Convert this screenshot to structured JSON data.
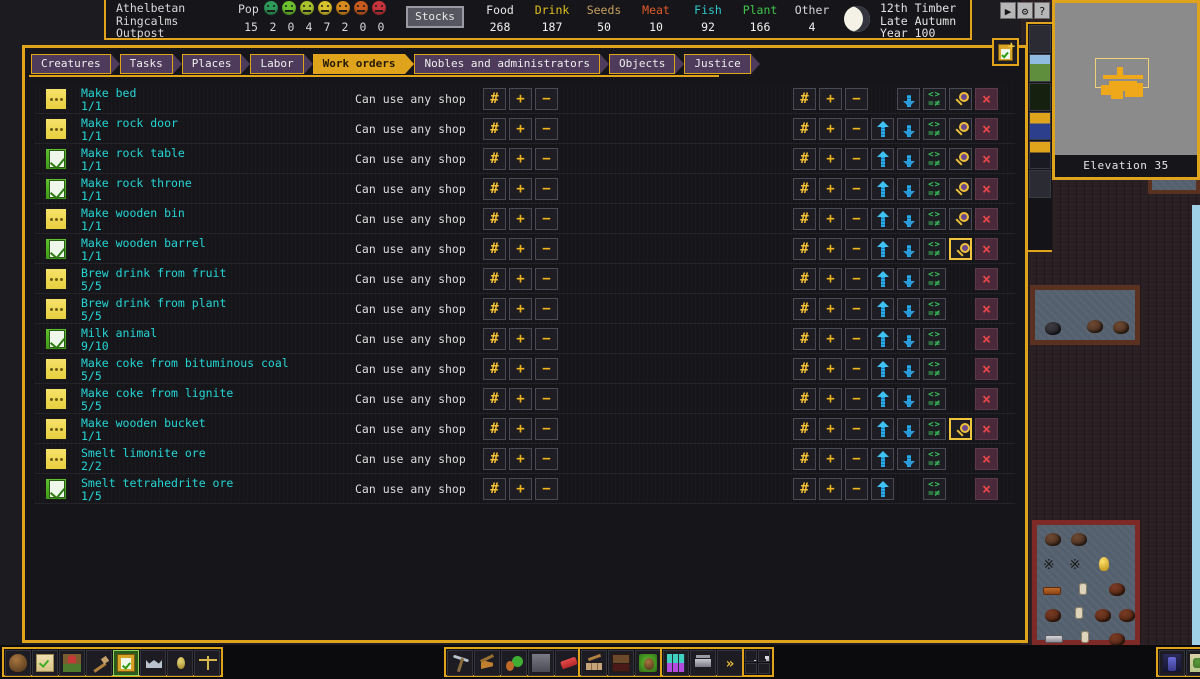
{
  "window": {
    "elevation_label": "Elevation 35"
  },
  "status_bar": {
    "fort_name_line1": "Athelbetan",
    "fort_name_line2": "Ringcalms",
    "fort_type": "Outpost",
    "pop_label": "Pop",
    "pop_total": "15",
    "mood_counts": [
      "2",
      "0",
      "4",
      "7",
      "2",
      "0",
      "0"
    ],
    "mood_colors": [
      "#2e9a5a",
      "#6cc22e",
      "#a8c22e",
      "#d8c22e",
      "#d88a1e",
      "#c85a1e",
      "#c8343c"
    ],
    "stocks_label": "Stocks",
    "resources": [
      {
        "name": "Food",
        "value": "268",
        "color": "#e8e8e8"
      },
      {
        "name": "Drink",
        "value": "187",
        "color": "#e0c020"
      },
      {
        "name": "Seeds",
        "value": "50",
        "color": "#c8a060"
      },
      {
        "name": "Meat",
        "value": "10",
        "color": "#e05a2a"
      },
      {
        "name": "Fish",
        "value": "92",
        "color": "#2ec8c8"
      },
      {
        "name": "Plant",
        "value": "166",
        "color": "#3fc44a"
      },
      {
        "name": "Other",
        "value": "4",
        "color": "#d8d8d8"
      }
    ],
    "date_line1": "12th Timber",
    "date_line2": "Late Autumn",
    "date_line3": "Year 100"
  },
  "top_right_controls": [
    "▶",
    "⚙",
    "?"
  ],
  "tabs": [
    {
      "label": "Creatures",
      "active": false
    },
    {
      "label": "Tasks",
      "active": false
    },
    {
      "label": "Places",
      "active": false
    },
    {
      "label": "Labor",
      "active": false
    },
    {
      "label": "Work orders",
      "active": true
    },
    {
      "label": "Nobles and administrators",
      "active": false
    },
    {
      "label": "Objects",
      "active": false
    },
    {
      "label": "Justice",
      "active": false
    }
  ],
  "add_order_button": {
    "label": "+",
    "name": "add-work-order"
  },
  "row_buttons": {
    "hash": "#",
    "plus": "+",
    "minus": "−",
    "delete": "×",
    "cond_top": "<>",
    "cond_bottom": "=≠"
  },
  "work_orders": [
    {
      "title": "Make bed",
      "count": "1/1",
      "shop": "Can use any shop",
      "status": "pending",
      "up": false,
      "down": true,
      "conditions": true,
      "details": true,
      "selected_details": false
    },
    {
      "title": "Make rock door",
      "count": "1/1",
      "shop": "Can use any shop",
      "status": "pending",
      "up": true,
      "down": true,
      "conditions": true,
      "details": true,
      "selected_details": false
    },
    {
      "title": "Make rock table",
      "count": "1/1",
      "shop": "Can use any shop",
      "status": "active",
      "up": true,
      "down": true,
      "conditions": true,
      "details": true,
      "selected_details": false
    },
    {
      "title": "Make rock throne",
      "count": "1/1",
      "shop": "Can use any shop",
      "status": "active",
      "up": true,
      "down": true,
      "conditions": true,
      "details": true,
      "selected_details": false
    },
    {
      "title": "Make wooden bin",
      "count": "1/1",
      "shop": "Can use any shop",
      "status": "pending",
      "up": true,
      "down": true,
      "conditions": true,
      "details": true,
      "selected_details": false
    },
    {
      "title": "Make wooden barrel",
      "count": "1/1",
      "shop": "Can use any shop",
      "status": "active",
      "up": true,
      "down": true,
      "conditions": true,
      "details": true,
      "selected_details": true
    },
    {
      "title": "Brew drink from fruit",
      "count": "5/5",
      "shop": "Can use any shop",
      "status": "pending",
      "up": true,
      "down": true,
      "conditions": true,
      "details": false,
      "selected_details": false
    },
    {
      "title": "Brew drink from plant",
      "count": "5/5",
      "shop": "Can use any shop",
      "status": "pending",
      "up": true,
      "down": true,
      "conditions": true,
      "details": false,
      "selected_details": false
    },
    {
      "title": "Milk animal",
      "count": "9/10",
      "shop": "Can use any shop",
      "status": "active",
      "up": true,
      "down": true,
      "conditions": true,
      "details": false,
      "selected_details": false
    },
    {
      "title": "Make coke from bituminous coal",
      "count": "5/5",
      "shop": "Can use any shop",
      "status": "pending",
      "up": true,
      "down": true,
      "conditions": true,
      "details": false,
      "selected_details": false
    },
    {
      "title": "Make coke from lignite",
      "count": "5/5",
      "shop": "Can use any shop",
      "status": "pending",
      "up": true,
      "down": true,
      "conditions": true,
      "details": false,
      "selected_details": false
    },
    {
      "title": "Make wooden bucket",
      "count": "1/1",
      "shop": "Can use any shop",
      "status": "pending",
      "up": true,
      "down": true,
      "conditions": true,
      "details": true,
      "selected_details": true
    },
    {
      "title": "Smelt limonite ore",
      "count": "2/2",
      "shop": "Can use any shop",
      "status": "pending",
      "up": true,
      "down": true,
      "conditions": true,
      "details": false,
      "selected_details": false
    },
    {
      "title": "Smelt tetrahedrite ore",
      "count": "1/5",
      "shop": "Can use any shop",
      "status": "active",
      "up": true,
      "down": false,
      "conditions": true,
      "details": false,
      "selected_details": false
    }
  ],
  "bottom_toolbar": {
    "group_left": [
      {
        "icon": "creatures-icon",
        "glyph": "g-head",
        "on": false
      },
      {
        "icon": "tasks-icon",
        "glyph": "g-scroll",
        "on": false
      },
      {
        "icon": "places-icon",
        "glyph": "g-tent",
        "on": false
      },
      {
        "icon": "labor-icon",
        "glyph": "g-hammer",
        "on": false
      },
      {
        "icon": "work-orders-icon",
        "glyph": "g-clip",
        "on": true
      },
      {
        "icon": "nobles-icon",
        "glyph": "g-crown",
        "on": false
      },
      {
        "icon": "objects-icon",
        "glyph": "g-gem",
        "on": false
      },
      {
        "icon": "justice-icon",
        "glyph": "g-scales",
        "on": false
      }
    ],
    "group_designations": [
      {
        "icon": "dig-icon",
        "glyph": "g-pick",
        "on": false
      },
      {
        "icon": "chop-trees-icon",
        "glyph": "g-axe",
        "on": false
      },
      {
        "icon": "gather-plants-icon",
        "glyph": "g-plant",
        "on": false
      },
      {
        "icon": "smooth-stone-icon",
        "glyph": "g-stone",
        "on": false
      },
      {
        "icon": "erase-designation-icon",
        "glyph": "g-eraser",
        "on": false
      }
    ],
    "group_build": [
      {
        "icon": "build-icon",
        "glyph": "g-brick",
        "on": false
      },
      {
        "icon": "workshop-icon",
        "glyph": "g-shop",
        "on": false
      },
      {
        "icon": "squads-icon",
        "glyph": "g-squad",
        "on": false
      }
    ],
    "group_zones": [
      {
        "icon": "zones-icon",
        "glyph": "g-zone",
        "on": false
      },
      {
        "icon": "hauling-icon",
        "glyph": "g-cart",
        "on": false
      },
      {
        "icon": "advance-time-icon",
        "glyph": "g-chev",
        "on": false
      }
    ],
    "group_misc": [
      {
        "icon": "lock-icon",
        "glyph": "g-lock",
        "on": false
      },
      {
        "icon": "trash-icon",
        "glyph": "g-trash",
        "on": false
      },
      {
        "icon": "temperature-icon",
        "glyph": "g-fire",
        "on": false
      },
      {
        "icon": "visibility-icon",
        "glyph": "g-eye",
        "on": false
      }
    ],
    "group_right": [
      {
        "icon": "announcements-icon",
        "glyph": "g-scrollblue",
        "on": false
      },
      {
        "icon": "world-map-icon",
        "glyph": "g-map",
        "on": false
      }
    ],
    "advance_chevrons": "»"
  },
  "minimap_rail": [
    {
      "icon": "center-view-icon",
      "style": "dark"
    },
    {
      "icon": "surface-map-icon",
      "style": "map-grass"
    },
    {
      "icon": "forest-map-icon",
      "style": "map-tree"
    },
    {
      "icon": "blueprint-map-icon",
      "style": "map-blue"
    },
    {
      "icon": "stockpile-map-icon",
      "style": "map-white"
    },
    {
      "icon": "blank-map-icon",
      "style": "dark"
    }
  ]
}
